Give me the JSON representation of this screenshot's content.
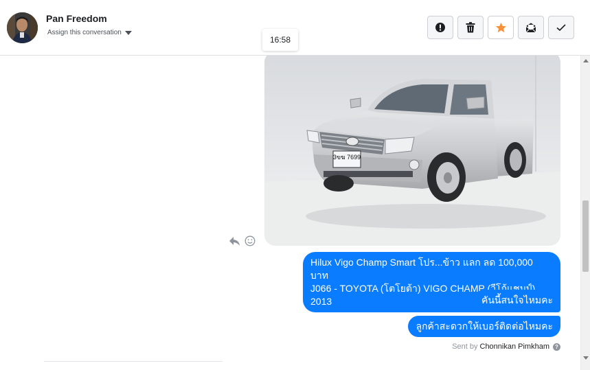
{
  "header": {
    "contact_name": "Pan Freedom",
    "assign_label": "Assign this conversation",
    "timestamp_tooltip": "16:58",
    "actions": [
      {
        "name": "mark-spam-button",
        "icon": "exclamation-circle-icon"
      },
      {
        "name": "delete-button",
        "icon": "trash-icon"
      },
      {
        "name": "star-button",
        "icon": "star-icon",
        "color": "#f7923a"
      },
      {
        "name": "mark-unread-button",
        "icon": "envelope-icon"
      },
      {
        "name": "mark-done-button",
        "icon": "checkmark-icon"
      }
    ]
  },
  "thread": {
    "photo": {
      "subject": "silver Toyota Hilux Vigo pickup truck",
      "plate": "3ขฆ 7699"
    },
    "messages": [
      {
        "lines": [
          "Hilux Vigo Champ Smart โปร...ข้าว แลก ลด 100,000 บาท",
          "J066 - TOYOTA (โตโยต้า) VIGO CHAMP (วีโก้แชมป์) 2013"
        ]
      },
      {
        "lines": [
          "คันนี้สนใจไหมคะ"
        ]
      },
      {
        "lines": [
          "ลูกค้าสะดวกให้เบอร์ติดต่อไหมคะ"
        ]
      }
    ],
    "sent_by_prefix": "Sent by",
    "sent_by_agent": "Chonnikan Pimkham",
    "help_glyph": "?"
  },
  "colors": {
    "bubble": "#0a7cff",
    "star": "#f7923a"
  }
}
